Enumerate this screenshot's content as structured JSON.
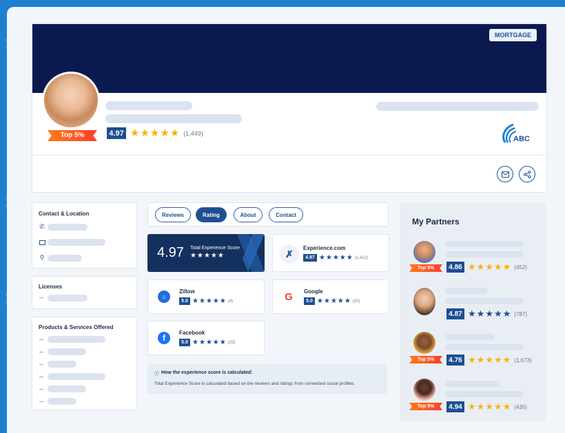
{
  "header": {
    "tag": "MORTGAGE",
    "rating": "4.97",
    "review_count": "(1,449)",
    "ribbon": "Top 5%",
    "brand": "ABC"
  },
  "sidebar": {
    "contact_title": "Contact & Location",
    "licenses_title": "Licenses",
    "products_title": "Products & Services Offered"
  },
  "tabs": [
    "Reviews",
    "Rating",
    "About",
    "Contact"
  ],
  "active_tab": "Rating",
  "score": {
    "value": "4.97",
    "label": "Total Experience Score"
  },
  "sources": [
    {
      "name": "Experience.com",
      "rating": "4.97",
      "count": "(1,412)",
      "icon": "experience-icon"
    },
    {
      "name": "Zillow",
      "rating": "5.0",
      "count": "(4)",
      "icon": "zillow-icon"
    },
    {
      "name": "Google",
      "rating": "5.0",
      "count": "(10)",
      "icon": "google-icon"
    },
    {
      "name": "Facebook",
      "rating": "5.0",
      "count": "(23)",
      "icon": "facebook-icon"
    }
  ],
  "info": {
    "title": "How the experience score is calculated:",
    "text": "Total Experience Score is calculated based on the reviews and ratings from connected social profiles."
  },
  "partners": {
    "title": "My Partners",
    "items": [
      {
        "rating": "4.86",
        "count": "(452)",
        "ribbon": "Top 5%",
        "stars": "gold"
      },
      {
        "rating": "4.87",
        "count": "(787)",
        "ribbon": "",
        "stars": "blue"
      },
      {
        "rating": "4.76",
        "count": "(1,673)",
        "ribbon": "Top 5%",
        "stars": "gold"
      },
      {
        "rating": "4.94",
        "count": "(435)",
        "ribbon": "Top 5%",
        "stars": "gold"
      }
    ]
  },
  "colors": {
    "navy": "#0b1a4e",
    "accent": "#1d4f91",
    "gold": "#f5b50a",
    "background": "#1d7fd0"
  }
}
